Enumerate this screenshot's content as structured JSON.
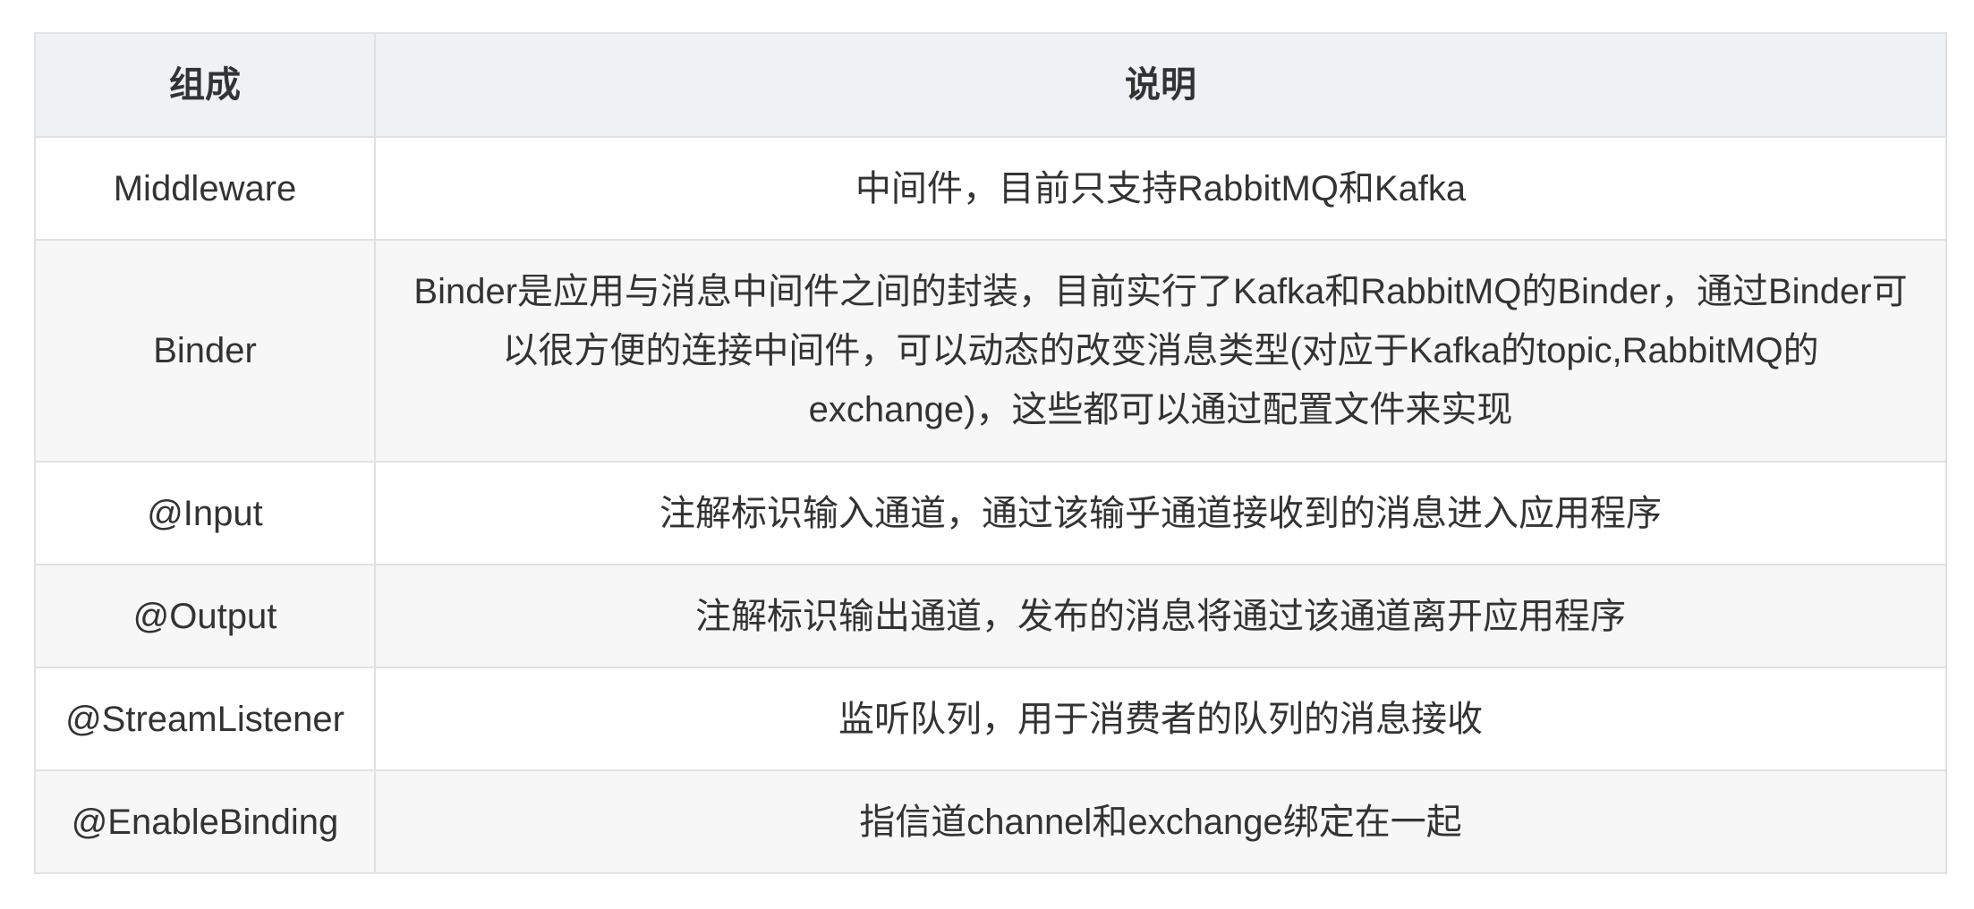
{
  "table": {
    "headers": [
      "组成",
      "说明"
    ],
    "rows": [
      {
        "name": "Middleware",
        "desc": "中间件，目前只支持RabbitMQ和Kafka"
      },
      {
        "name": "Binder",
        "desc": "Binder是应用与消息中间件之间的封装，目前实行了Kafka和RabbitMQ的Binder，通过Binder可以很方便的连接中间件，可以动态的改变消息类型(对应于Kafka的topic,RabbitMQ的exchange)，这些都可以通过配置文件来实现"
      },
      {
        "name": "@Input",
        "desc": "注解标识输入通道，通过该输乎通道接收到的消息进入应用程序"
      },
      {
        "name": "@Output",
        "desc": "注解标识输出通道，发布的消息将通过该通道离开应用程序"
      },
      {
        "name": "@StreamListener",
        "desc": "监听队列，用于消费者的队列的消息接收"
      },
      {
        "name": "@EnableBinding",
        "desc": "指信道channel和exchange绑定在一起"
      }
    ]
  }
}
